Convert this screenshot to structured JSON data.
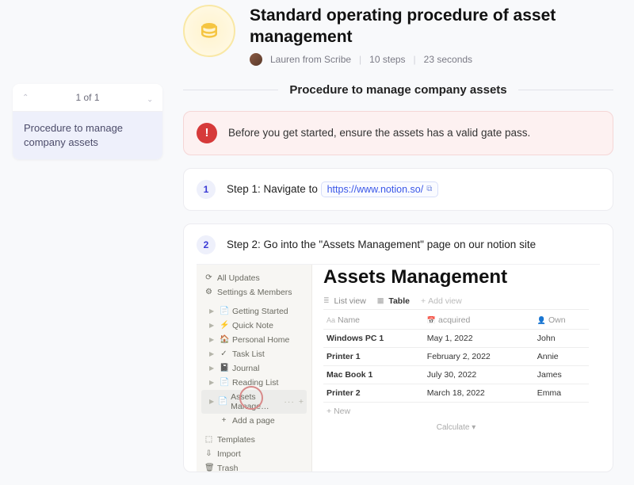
{
  "header": {
    "title": "Standard operating procedure of asset management",
    "author": "Lauren from Scribe",
    "steps": "10 steps",
    "duration": "23 seconds"
  },
  "toc": {
    "counter": "1 of 1",
    "items": [
      "Procedure to manage company assets"
    ]
  },
  "section_title": "Procedure to manage company assets",
  "alert": {
    "text": "Before you get started, ensure the assets has a valid gate pass."
  },
  "step1": {
    "num": "1",
    "prefix": "Step 1: Navigate to",
    "url": "https://www.notion.so/"
  },
  "step2": {
    "num": "2",
    "text": "Step 2: Go into the \"Assets Management\" page on our notion site"
  },
  "notion": {
    "sidebar_top": [
      {
        "glyph": "⟳",
        "label": "All Updates"
      },
      {
        "glyph": "⚙",
        "label": "Settings & Members"
      }
    ],
    "pages": [
      {
        "glyph": "📄",
        "label": "Getting Started"
      },
      {
        "glyph": "⚡",
        "label": "Quick Note"
      },
      {
        "glyph": "🏠",
        "label": "Personal Home"
      },
      {
        "glyph": "✓",
        "label": "Task List"
      },
      {
        "glyph": "📓",
        "label": "Journal"
      },
      {
        "glyph": "📄",
        "label": "Reading List"
      },
      {
        "glyph": "📄",
        "label": "Assets Manage…",
        "selected": true
      }
    ],
    "add_page": "Add a page",
    "bottom": [
      {
        "glyph": "⬚",
        "label": "Templates"
      },
      {
        "glyph": "⇩",
        "label": "Import"
      },
      {
        "glyph": "🗑",
        "label": "Trash"
      }
    ],
    "main": {
      "title": "Assets Management",
      "tabs": {
        "list": "List view",
        "table": "Table",
        "add": "Add view"
      },
      "columns": [
        "Name",
        "acquired",
        "Own"
      ],
      "rows": [
        {
          "name": "Windows PC 1",
          "acquired": "May 1, 2022",
          "own": "John"
        },
        {
          "name": "Printer 1",
          "acquired": "February 2, 2022",
          "own": "Annie"
        },
        {
          "name": "Mac Book 1",
          "acquired": "July 30, 2022",
          "own": "James"
        },
        {
          "name": "Printer 2",
          "acquired": "March 18, 2022",
          "own": "Emma"
        }
      ],
      "new": "New",
      "calc": "Calculate ▾"
    }
  }
}
